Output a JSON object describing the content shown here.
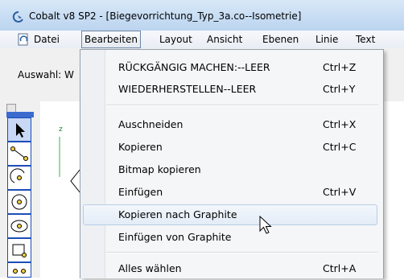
{
  "window": {
    "title": "Cobalt v8 SP2 - [Biegevorrichtung_Typ_3a.co--Isometrie]"
  },
  "menubar": {
    "items": [
      "Datei",
      "Bearbeiten",
      "Layout",
      "Ansicht",
      "Ebenen",
      "Linie",
      "Text"
    ],
    "active": "Bearbeiten"
  },
  "toolbar": {
    "selection_label": "Auswahl: W"
  },
  "canvas": {
    "axis_label": "z"
  },
  "edit_menu": {
    "items": [
      {
        "label": "RÜCKGÄNGIG MACHEN:--LEER",
        "shortcut": "Ctrl+Z"
      },
      {
        "label": "WIEDERHERSTELLEN--LEER",
        "shortcut": "Ctrl+Y"
      },
      {
        "label": "Auschneiden",
        "shortcut": "Ctrl+X"
      },
      {
        "label": "Kopieren",
        "shortcut": "Ctrl+C"
      },
      {
        "label": "Bitmap kopieren",
        "shortcut": ""
      },
      {
        "label": "Einfügen",
        "shortcut": "Ctrl+V"
      },
      {
        "label": "Kopieren nach Graphite",
        "shortcut": "",
        "highlighted": true
      },
      {
        "label": "Einfügen von Graphite",
        "shortcut": ""
      },
      {
        "label": "Alles wählen",
        "shortcut": "Ctrl+A"
      }
    ]
  },
  "colors": {
    "palette_accent": "#1c4db7",
    "menu_highlight": "#e3ecf7"
  }
}
